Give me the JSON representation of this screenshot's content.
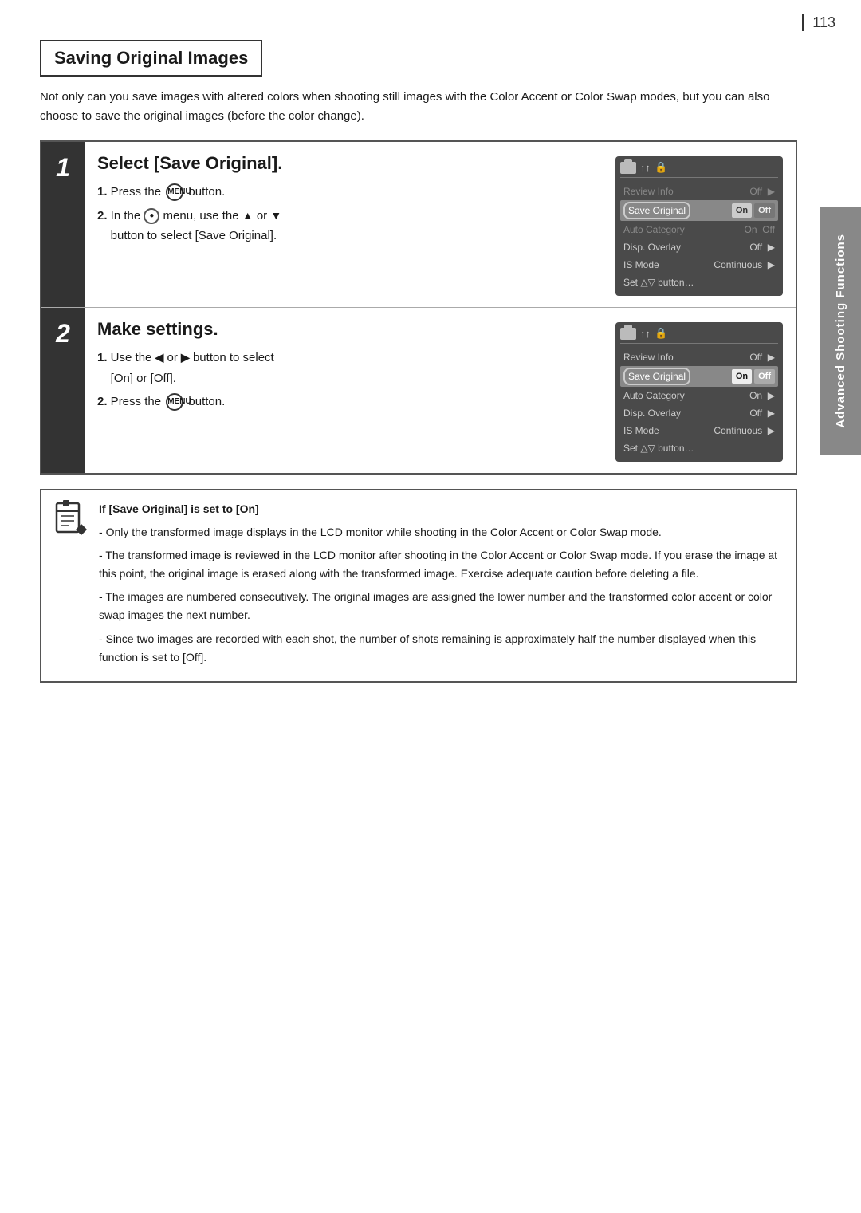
{
  "page": {
    "number": "113",
    "section_title": "Saving Original Images",
    "intro": "Not only can you save images with altered colors when shooting still images with the Color Accent or Color Swap modes, but you can also choose to save the original images (before the color change).",
    "steps": [
      {
        "number": "1",
        "heading": "Select [Save Original].",
        "instructions": [
          "Press the MENU button.",
          "In the [●] menu, use the ▲ or ▼ button to select [Save Original]."
        ]
      },
      {
        "number": "2",
        "heading": "Make settings.",
        "instructions": [
          "Use the ◀ or ▶ button to select [On] or [Off].",
          "Press the MENU button."
        ]
      }
    ],
    "lcd_menu_1": {
      "rows": [
        {
          "label": "Review Info",
          "value": "Off",
          "highlighted": false,
          "dimmed": false
        },
        {
          "label": "Save Original",
          "value": "On Off",
          "highlighted": true,
          "dimmed": false,
          "oval": true
        },
        {
          "label": "Auto Category",
          "value": "On",
          "highlighted": false,
          "dimmed": true
        },
        {
          "label": "Disp. Overlay",
          "value": "Off",
          "highlighted": false,
          "dimmed": false
        },
        {
          "label": "IS Mode",
          "value": "Continuous",
          "highlighted": false,
          "dimmed": false
        },
        {
          "label": "Set △▽ button…",
          "value": "",
          "highlighted": false,
          "dimmed": false
        }
      ]
    },
    "lcd_menu_2": {
      "rows": [
        {
          "label": "Review Info",
          "value": "Off",
          "highlighted": false,
          "dimmed": false
        },
        {
          "label": "Save Original",
          "value": "On Off",
          "highlighted": true,
          "dimmed": false,
          "on_selected": true
        },
        {
          "label": "Auto Category",
          "value": "On",
          "highlighted": false,
          "dimmed": false
        },
        {
          "label": "Disp. Overlay",
          "value": "Off",
          "highlighted": false,
          "dimmed": false
        },
        {
          "label": "IS Mode",
          "value": "Continuous",
          "highlighted": false,
          "dimmed": false
        },
        {
          "label": "Set △▽ button…",
          "value": "",
          "highlighted": false,
          "dimmed": false
        }
      ]
    },
    "note": {
      "title": "If [Save Original] is set to [On]",
      "bullets": [
        "Only the transformed image displays in the LCD monitor while shooting in the Color Accent or Color Swap mode.",
        "The transformed image is reviewed in the LCD monitor after shooting in the Color Accent or Color Swap mode. If you erase the image at this point, the original image is erased along with the transformed image. Exercise adequate caution before deleting a file.",
        "The images are numbered consecutively. The original images are assigned the lower number and the transformed color accent or color swap images the next number.",
        "Since two images are recorded with each shot, the number of shots remaining is approximately half the number displayed when this function is set to [Off]."
      ]
    },
    "sidebar": {
      "label": "Advanced Shooting Functions"
    }
  }
}
